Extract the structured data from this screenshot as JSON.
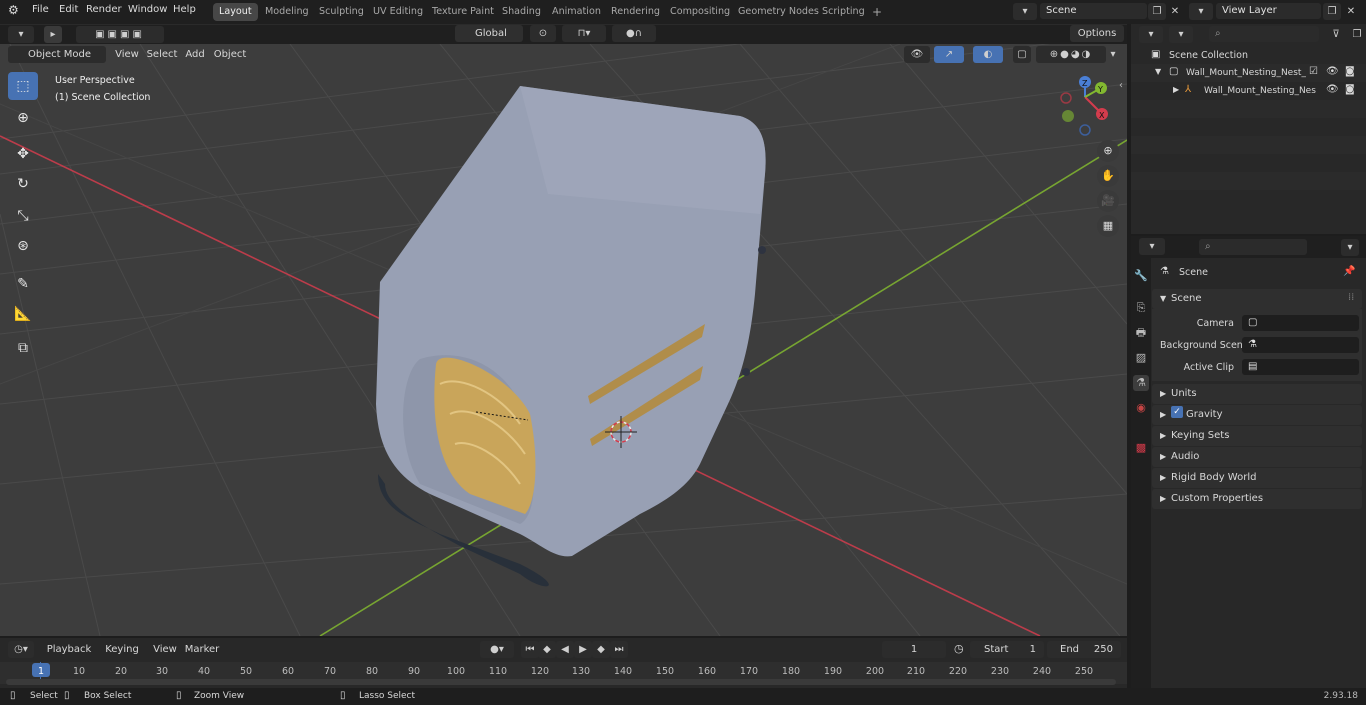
{
  "topbar": {
    "menus": [
      "File",
      "Edit",
      "Render",
      "Window",
      "Help"
    ],
    "workspaces": [
      "Layout",
      "Modeling",
      "Sculpting",
      "UV Editing",
      "Texture Paint",
      "Shading",
      "Animation",
      "Rendering",
      "Compositing",
      "Geometry Nodes",
      "Scripting"
    ],
    "active_workspace": "Layout",
    "add_tab": "+",
    "scene_name": "Scene",
    "view_layer": "View Layer"
  },
  "viewport_header": {
    "mode": "Object Mode",
    "menus": [
      "View",
      "Select",
      "Add",
      "Object"
    ],
    "transform_orientation": "Global",
    "options": "Options"
  },
  "viewport": {
    "perspective_label": "User Perspective",
    "collection_label": "(1) Scene Collection",
    "gizmo": {
      "x": "X",
      "y": "Y",
      "z": "Z"
    },
    "colors": {
      "x_axis": "#d33c4d",
      "y_axis": "#82b830",
      "grid_bg": "#3d3d3d",
      "object": "#98a0b4",
      "accent": "#4772b3"
    }
  },
  "outliner": {
    "scene_collection": "Scene Collection",
    "items": [
      {
        "label": "Wall_Mount_Nesting_Nest_Bo",
        "level": 1
      },
      {
        "label": "Wall_Mount_Nesting_Nes",
        "level": 2
      }
    ]
  },
  "properties": {
    "header_title": "Scene",
    "panel_title": "Scene",
    "fields": [
      {
        "label": "Camera",
        "value": ""
      },
      {
        "label": "Background Scene",
        "value": ""
      },
      {
        "label": "Active Clip",
        "value": ""
      }
    ],
    "sections": [
      "Units",
      "Gravity",
      "Keying Sets",
      "Audio",
      "Rigid Body World",
      "Custom Properties"
    ],
    "gravity_checked": true
  },
  "timeline": {
    "menus": [
      "Playback",
      "Keying",
      "View",
      "Marker"
    ],
    "current_frame": "1",
    "start_label": "Start",
    "start_value": "1",
    "end_label": "End",
    "end_value": "250",
    "ticks": [
      "1",
      "10",
      "20",
      "30",
      "40",
      "50",
      "60",
      "70",
      "80",
      "90",
      "100",
      "110",
      "120",
      "130",
      "140",
      "150",
      "160",
      "170",
      "180",
      "190",
      "200",
      "210",
      "220",
      "230",
      "240",
      "250"
    ]
  },
  "statusbar": {
    "select": "Select",
    "box_select": "Box Select",
    "zoom_view": "Zoom View",
    "lasso_select": "Lasso Select",
    "version": "2.93.18"
  }
}
